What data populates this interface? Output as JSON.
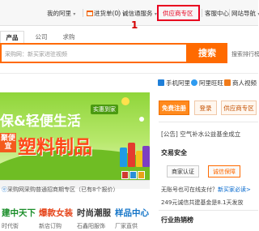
{
  "topnav": {
    "my_alibaba": "我的阿里",
    "cart": "进货单(0)",
    "trust": "诚信通服务",
    "supplier_zone": "供应商专区",
    "service_center": "客服中心",
    "site_nav": "网站导航",
    "caret": "▾",
    "marker": "1",
    "highlight_color": "#e8001f"
  },
  "search": {
    "tabs": [
      "产品",
      "公司",
      "求购"
    ],
    "placeholder": "采购网：新买家进驻视频",
    "button": "搜索",
    "rank_link": "搜索排行榜"
  },
  "apps": [
    "手机阿里",
    "阿里旺旺",
    "商人视频"
  ],
  "banner": {
    "line1": "保&轻便生活",
    "chip": "实惠到家",
    "badge": "聚便宜",
    "line2": "塑料制品"
  },
  "news": {
    "tag": "ⓔ",
    "text": "采购网采购普通招商期专区（已有8个报价）"
  },
  "categories": [
    {
      "title": "建中天下",
      "sub": "时代街",
      "color": "#1b8e2a"
    },
    {
      "title": "爆款女装",
      "sub": "新店订购",
      "color": "#e6451b"
    },
    {
      "title": "时尚潮服",
      "sub": "石鑫阳服饰",
      "color": "#333333"
    },
    {
      "title": "样品中心",
      "sub": "厂家直供",
      "color": "#1676c8"
    }
  ],
  "right": {
    "register": "免费注册",
    "login": "登录",
    "supplier": "供应商专区",
    "notice": "[公告]  空气补水公益基金成立",
    "trade_title": "交易安全",
    "merchant_auth": "商家认证",
    "trust_guarantee": "诚信保障",
    "line1_a": "无账号也可在线支付？",
    "line1_b": "新买家必读>",
    "line2": "249元诚信共建基金是8.1天发放",
    "hot_title": "行业热销榜"
  }
}
